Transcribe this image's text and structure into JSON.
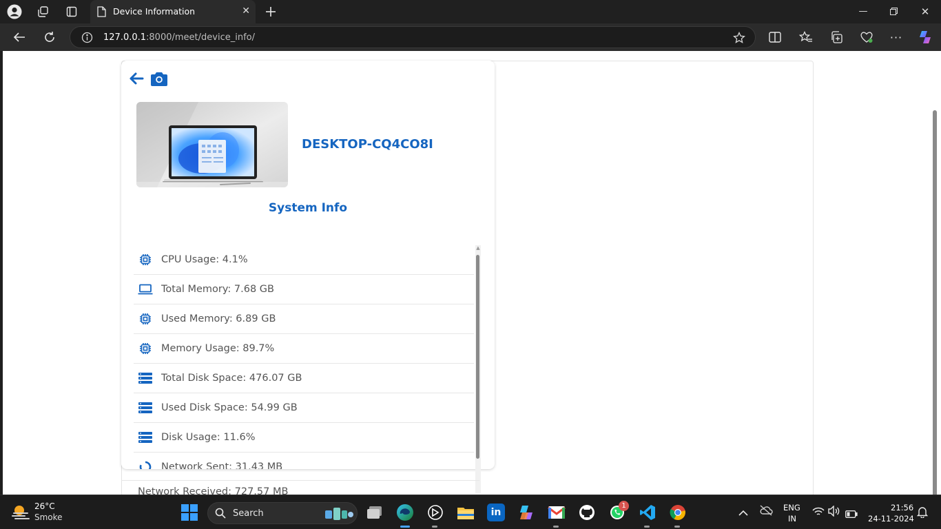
{
  "browser": {
    "tab_title": "Device Information",
    "url_host": "127.0.0.1",
    "url_rest": ":8000/meet/device_info/"
  },
  "page": {
    "device_name": "DESKTOP-CQ4CO8I",
    "section_title": "System Info",
    "rows": [
      {
        "icon": "chip-icon",
        "label": "CPU Usage: 4.1%"
      },
      {
        "icon": "laptop-icon",
        "label": "Total Memory: 7.68 GB"
      },
      {
        "icon": "chip-icon",
        "label": "Used Memory: 6.89 GB"
      },
      {
        "icon": "chip-icon",
        "label": "Memory Usage: 89.7%"
      },
      {
        "icon": "server-icon",
        "label": "Total Disk Space: 476.07 GB"
      },
      {
        "icon": "server-icon",
        "label": "Used Disk Space: 54.99 GB"
      },
      {
        "icon": "server-icon",
        "label": "Disk Usage: 11.6%"
      },
      {
        "icon": "network-icon",
        "label": "Network Sent: 31.43 MB"
      }
    ],
    "partial_row": "Network Received: 727.57 MB"
  },
  "taskbar": {
    "weather_temp": "26°C",
    "weather_desc": "Smoke",
    "search_label": "Search",
    "whatsapp_badge": "1",
    "lang_top": "ENG",
    "lang_bottom": "IN",
    "time": "21:56",
    "date": "24-11-2024"
  },
  "colors": {
    "accent": "#1565c0",
    "browser_bg": "#2b2b2b",
    "taskbar_bg": "#1c1c1c"
  }
}
